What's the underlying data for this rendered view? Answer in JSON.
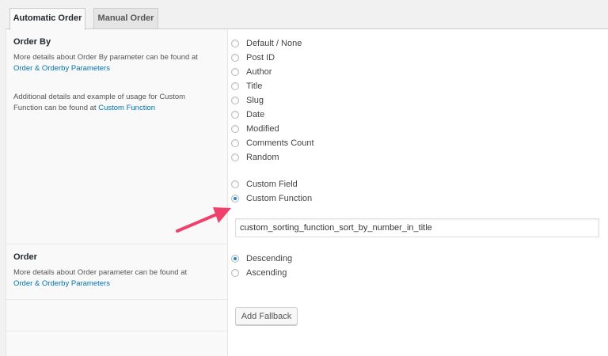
{
  "tabs": [
    {
      "label": "Automatic Order",
      "active": true
    },
    {
      "label": "Manual Order",
      "active": false
    }
  ],
  "order_by": {
    "heading": "Order By",
    "desc1": "More details about Order By parameter can be found at",
    "link1": "Order & Orderby Parameters",
    "desc2": "Additional details and example of usage for Custom Function can be found at",
    "link2": "Custom Function",
    "options": [
      "Default / None",
      "Post ID",
      "Author",
      "Title",
      "Slug",
      "Date",
      "Modified",
      "Comments Count",
      "Random"
    ],
    "extra_options": [
      "Custom Field",
      "Custom Function"
    ],
    "selected": "Custom Function",
    "function_value": "custom_sorting_function_sort_by_number_in_title"
  },
  "order": {
    "heading": "Order",
    "desc": "More details about Order parameter can be found at",
    "link": "Order & Orderby Parameters",
    "options": [
      "Descending",
      "Ascending"
    ],
    "selected": "Descending"
  },
  "fallback_button": "Add Fallback",
  "colors": {
    "link": "#0073aa",
    "arrow": "#f0406c",
    "radio_dot": "#1e8cbe"
  }
}
